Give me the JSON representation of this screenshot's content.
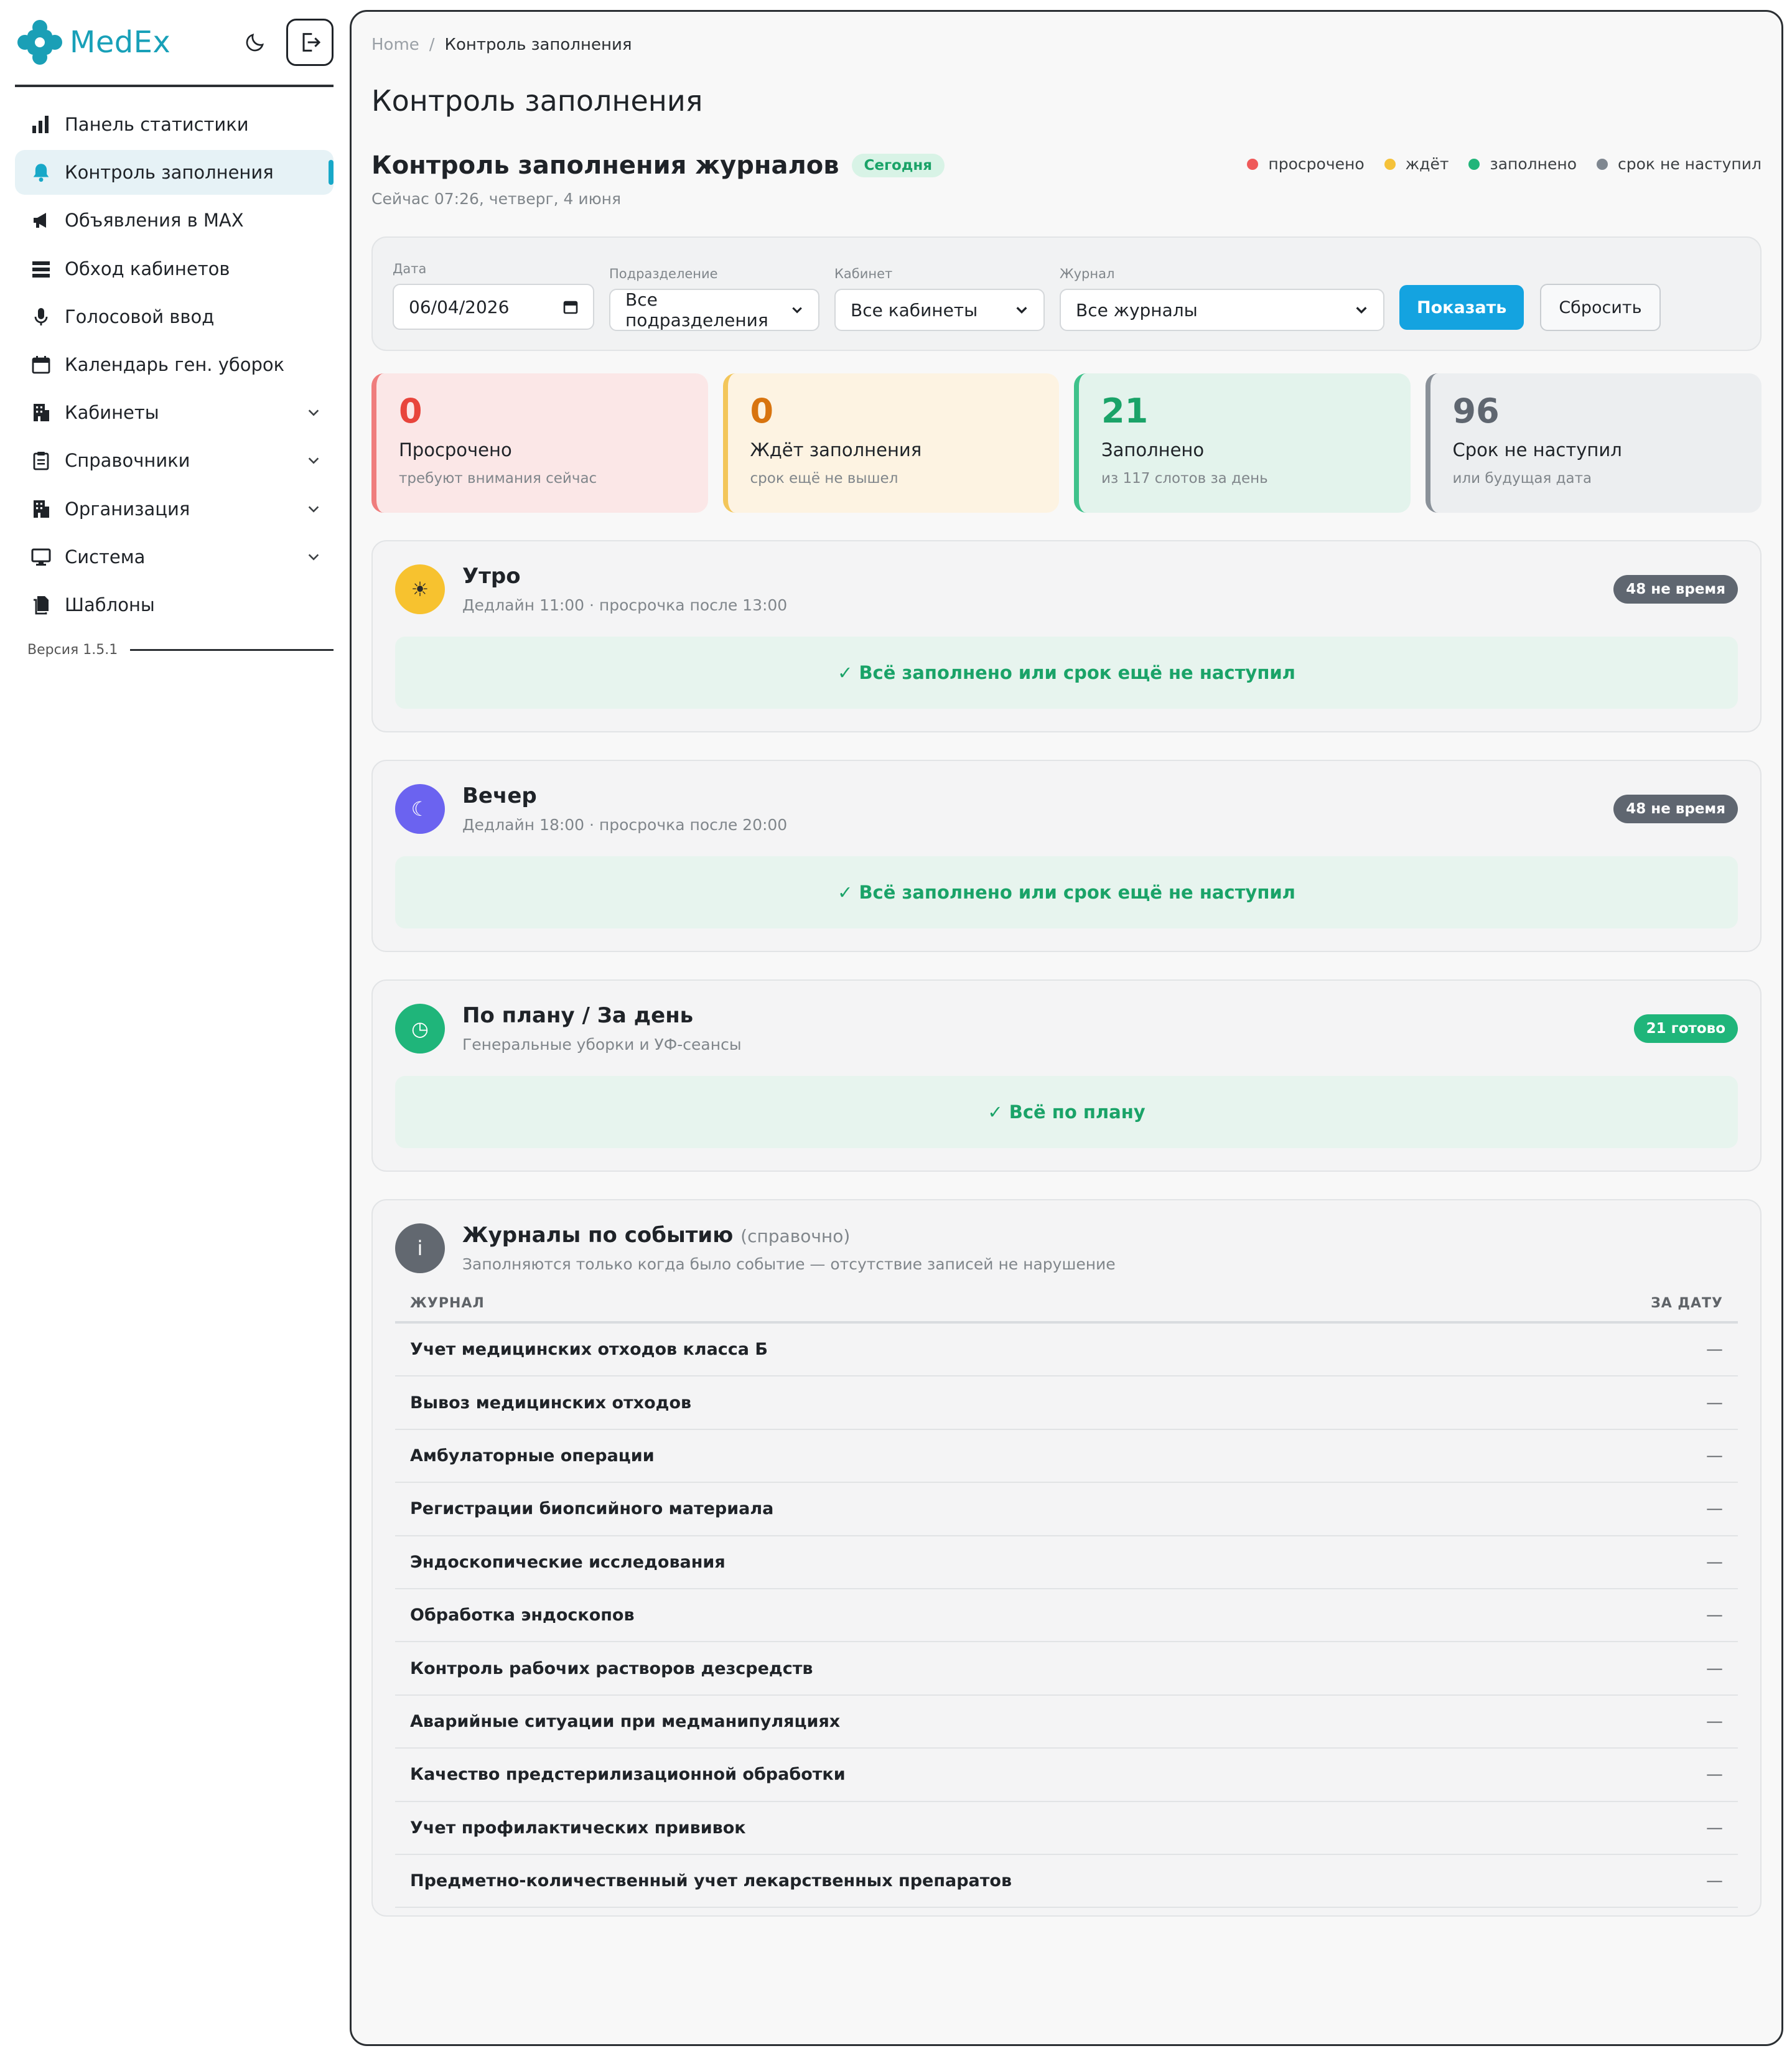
{
  "brand": {
    "name": "MedEx",
    "accent": "#18a0b8"
  },
  "sidebar": {
    "items": [
      {
        "label": "Панель статистики",
        "icon": "bar-chart-icon",
        "active": false,
        "expandable": false
      },
      {
        "label": "Контроль заполнения",
        "icon": "bell-icon",
        "active": true,
        "expandable": false
      },
      {
        "label": "Объявления в MAX",
        "icon": "megaphone-icon",
        "active": false,
        "expandable": false
      },
      {
        "label": "Обход кабинетов",
        "icon": "list-icon",
        "active": false,
        "expandable": false
      },
      {
        "label": "Голосовой ввод",
        "icon": "microphone-icon",
        "active": false,
        "expandable": false
      },
      {
        "label": "Календарь ген. уборок",
        "icon": "calendar-icon",
        "active": false,
        "expandable": false
      },
      {
        "label": "Кабинеты",
        "icon": "building-icon",
        "active": false,
        "expandable": true
      },
      {
        "label": "Справочники",
        "icon": "clipboard-icon",
        "active": false,
        "expandable": true
      },
      {
        "label": "Организация",
        "icon": "building-icon",
        "active": false,
        "expandable": true
      },
      {
        "label": "Система",
        "icon": "monitor-icon",
        "active": false,
        "expandable": true
      },
      {
        "label": "Шаблоны",
        "icon": "files-icon",
        "active": false,
        "expandable": false
      }
    ],
    "version": "Версия 1.5.1"
  },
  "breadcrumb": {
    "home": "Home",
    "sep": "/",
    "current": "Контроль заполнения"
  },
  "page_title": "Контроль заполнения",
  "section": {
    "title": "Контроль заполнения журналов",
    "today_badge": "Сегодня",
    "now": "Сейчас 07:26, четверг, 4 июня"
  },
  "legend": [
    {
      "label": "просрочено",
      "color": "#ef5a5a"
    },
    {
      "label": "ждёт",
      "color": "#f5c23a"
    },
    {
      "label": "заполнено",
      "color": "#22b57a"
    },
    {
      "label": "срок не наступил",
      "color": "#7f8790"
    }
  ],
  "filters": {
    "date": {
      "label": "Дата",
      "value": "06/04/2026"
    },
    "department": {
      "label": "Подразделение",
      "value": "Все подразделения"
    },
    "cabinet": {
      "label": "Кабинет",
      "value": "Все кабинеты"
    },
    "journal": {
      "label": "Журнал",
      "value": "Все журналы"
    },
    "show_button": "Показать",
    "reset_button": "Сбросить"
  },
  "stats": [
    {
      "value": "0",
      "title": "Просрочено",
      "sub": "требуют внимания сейчас",
      "color": "#e8453c",
      "bg": "#fbe7e7",
      "border": "#ef7d7d"
    },
    {
      "value": "0",
      "title": "Ждёт заполнения",
      "sub": "срок ещё не вышел",
      "color": "#d8740f",
      "bg": "#fdf3e2",
      "border": "#f3c65a"
    },
    {
      "value": "21",
      "title": "Заполнено",
      "sub": "из 117 слотов за день",
      "color": "#1aa368",
      "bg": "#e3f3ec",
      "border": "#3fc28b"
    },
    {
      "value": "96",
      "title": "Срок не наступил",
      "sub": "или будущая дата",
      "color": "#5f6670",
      "bg": "#eceef0",
      "border": "#8a9199"
    }
  ],
  "blocks": [
    {
      "title": "Утро",
      "sub": "Дедлайн 11:00 · просрочка после 13:00",
      "badge": "48 не время",
      "badge_color": "#5f6670",
      "icon": "sun-icon",
      "icon_glyph": "☀",
      "icon_bg": "#f7c22f",
      "ok": "✓ Всё заполнено или срок ещё не наступил"
    },
    {
      "title": "Вечер",
      "sub": "Дедлайн 18:00 · просрочка после 20:00",
      "badge": "48 не время",
      "badge_color": "#5f6670",
      "icon": "moon-icon",
      "icon_glyph": "☾",
      "icon_bg": "#6b63f0",
      "ok": "✓ Всё заполнено или срок ещё не наступил"
    },
    {
      "title": "По плану / За день",
      "sub": "Генеральные уборки и УФ-сеансы",
      "badge": "21 готово",
      "badge_color": "#1fb57a",
      "icon": "clock-icon",
      "icon_glyph": "◷",
      "icon_bg": "#1fb57a",
      "ok": "✓ Всё по плану"
    }
  ],
  "events": {
    "title": "Журналы по событию",
    "title_note": "(справочно)",
    "sub": "Заполняются только когда было событие — отсутствие записей не нарушение",
    "icon_glyph": "i",
    "columns": [
      "ЖУРНАЛ",
      "ЗА ДАТУ"
    ],
    "rows": [
      {
        "name": "Учет медицинских отходов класса Б",
        "value": "—"
      },
      {
        "name": "Вывоз медицинских отходов",
        "value": "—"
      },
      {
        "name": "Амбулаторные операции",
        "value": "—"
      },
      {
        "name": "Регистрации биопсийного материала",
        "value": "—"
      },
      {
        "name": "Эндоскопические исследования",
        "value": "—"
      },
      {
        "name": "Обработка эндоскопов",
        "value": "—"
      },
      {
        "name": "Контроль рабочих растворов дезсредств",
        "value": "—"
      },
      {
        "name": "Аварийные ситуации при медманипуляциях",
        "value": "—"
      },
      {
        "name": "Качество предстерилизационной обработки",
        "value": "—"
      },
      {
        "name": "Учет профилактических прививок",
        "value": "—"
      },
      {
        "name": "Предметно-количественный учет лекарственных препаратов",
        "value": "—"
      }
    ]
  }
}
